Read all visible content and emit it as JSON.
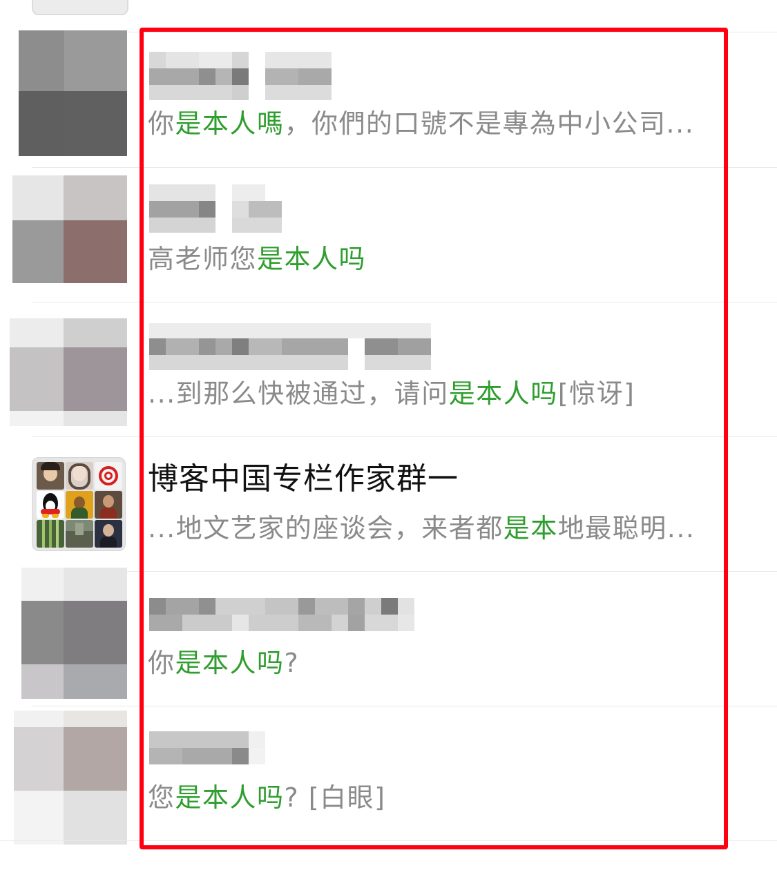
{
  "chats": [
    {
      "preview_parts": [
        {
          "text": "你",
          "hl": false
        },
        {
          "text": "是本人嗎",
          "hl": true
        },
        {
          "text": "，你們的口號不是專為中小公司...",
          "hl": false
        }
      ]
    },
    {
      "preview_parts": [
        {
          "text": "高老师您",
          "hl": false
        },
        {
          "text": "是本人吗",
          "hl": true
        }
      ]
    },
    {
      "preview_parts": [
        {
          "text": "...到那么快被通过，请问",
          "hl": false
        },
        {
          "text": "是本人吗",
          "hl": true
        },
        {
          "text": "[惊讶]",
          "hl": false
        }
      ]
    },
    {
      "name": "博客中国专栏作家群一",
      "preview_parts": [
        {
          "text": "...地文艺家的座谈会，来者都",
          "hl": false
        },
        {
          "text": "是本",
          "hl": true
        },
        {
          "text": "地最聪明...",
          "hl": false
        }
      ]
    },
    {
      "preview_parts": [
        {
          "text": "你",
          "hl": false
        },
        {
          "text": "是本人吗",
          "hl": true
        },
        {
          "text": "?",
          "hl": false
        }
      ]
    },
    {
      "preview_parts": [
        {
          "text": "您",
          "hl": false
        },
        {
          "text": "是本人吗",
          "hl": true
        },
        {
          "text": "? [白眼]",
          "hl": false
        }
      ]
    }
  ],
  "colors": {
    "highlight_text": "#2f9e2f",
    "box_outline": "#ff0010",
    "preview_text": "#8a8a8a",
    "name_text": "#111111"
  },
  "icons": {
    "group_avatar": "group-collage-icon"
  }
}
